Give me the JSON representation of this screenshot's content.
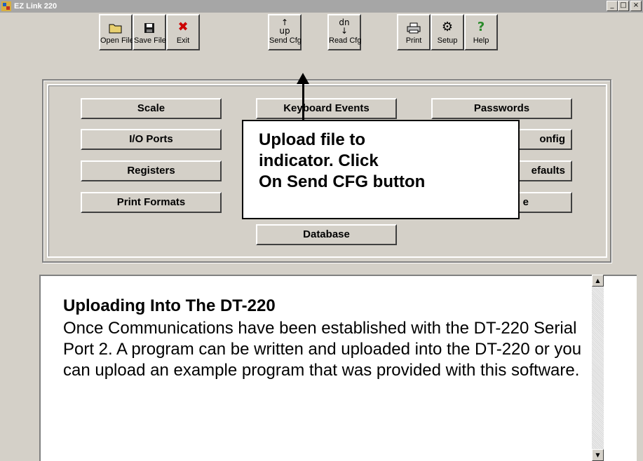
{
  "window": {
    "title": "EZ Link 220",
    "minimize": "_",
    "maximize": "□",
    "close": "×"
  },
  "toolbar": [
    {
      "label": "Open File",
      "icon": "📂",
      "name": "open-file-button",
      "icon_name": "folder-icon"
    },
    {
      "label": "Save File",
      "icon": "💾",
      "name": "save-file-button",
      "icon_name": "floppy-disk-icon"
    },
    {
      "label": "Exit",
      "icon": "✖",
      "name": "exit-button",
      "icon_name": "red-x-icon"
    },
    {
      "label": "Send Cfg",
      "icon": "↥",
      "name": "send-cfg-button",
      "icon_name": "upload-arrow-icon",
      "icon_text": "up"
    },
    {
      "label": "Read Cfg",
      "icon": "↧",
      "name": "read-cfg-button",
      "icon_name": "download-arrow-icon",
      "icon_text": "dn"
    },
    {
      "label": "Print",
      "icon": "🖨",
      "name": "print-button",
      "icon_name": "printer-icon"
    },
    {
      "label": "Setup",
      "icon": "⚙",
      "name": "setup-button",
      "icon_name": "tools-icon"
    },
    {
      "label": "Help",
      "icon": "?",
      "name": "help-button",
      "icon_name": "question-mark-icon"
    }
  ],
  "menu_buttons": {
    "scale": "Scale",
    "io_ports": "I/O Ports",
    "registers": "Registers",
    "print_formats": "Print Formats",
    "keyboard_events": "Keyboard Events",
    "database": "Database",
    "passwords": "Passwords",
    "config_partial": "onfig",
    "defaults_partial": "efaults",
    "partial_e": "e"
  },
  "callout": {
    "line1": "Upload file to",
    "line2": "indicator. Click",
    "line3": "On Send CFG button"
  },
  "help_text": {
    "heading": "Uploading Into The DT-220",
    "body": "Once Communications have been established with the DT-220 Serial Port 2. A program can be written and uploaded into the DT-220 or you can upload an example program that was provided with this software."
  },
  "scrollbar": {
    "up": "▲",
    "down": "▼"
  },
  "colors": {
    "title_bar": "#a6a6a6",
    "face": "#d4d0c8",
    "exit_icon": "#cc0000",
    "help_icon": "#2a8a2a"
  }
}
